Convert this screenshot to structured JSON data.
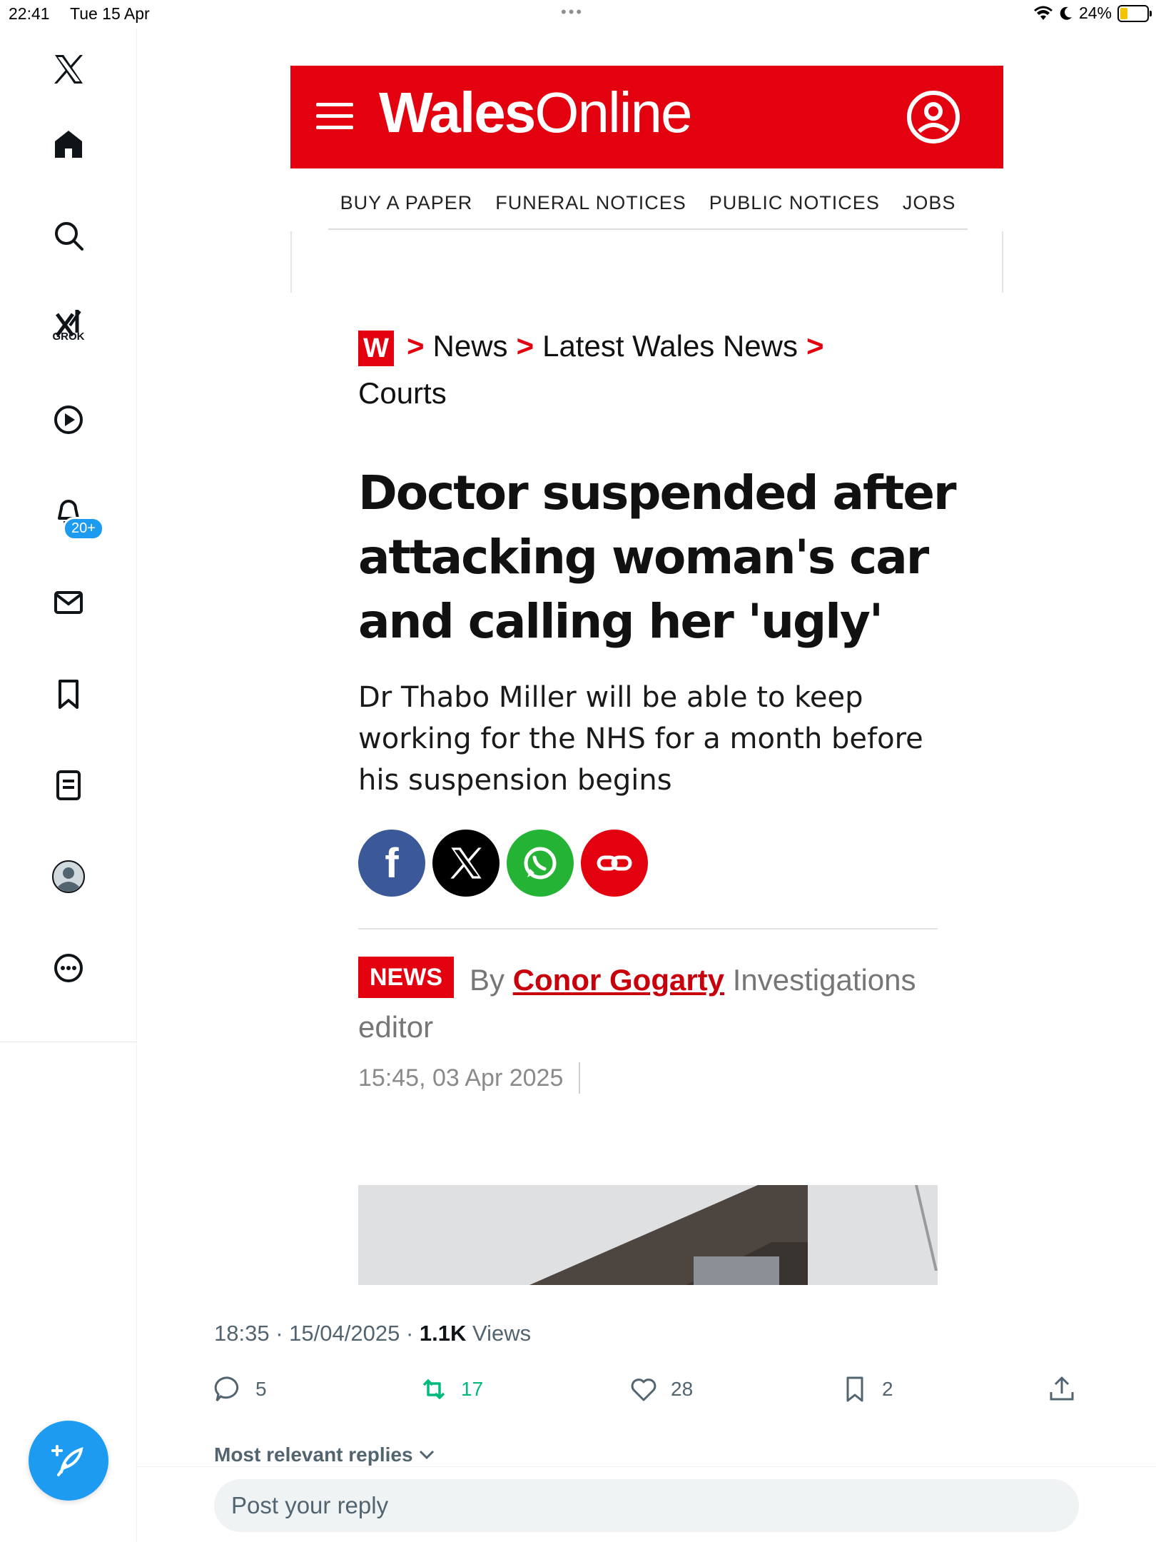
{
  "status": {
    "time": "22:41",
    "date": "Tue 15 Apr",
    "dots": "•••",
    "battery": "24%"
  },
  "sidebar": {
    "items": [
      {
        "name": "x-logo"
      },
      {
        "name": "home"
      },
      {
        "name": "search"
      },
      {
        "name": "grok",
        "label": "GROK"
      },
      {
        "name": "video"
      },
      {
        "name": "notifications",
        "badge": "20+"
      },
      {
        "name": "messages"
      },
      {
        "name": "bookmarks"
      },
      {
        "name": "lists"
      },
      {
        "name": "profile"
      },
      {
        "name": "more"
      }
    ],
    "accent": "#1d9bf0"
  },
  "article": {
    "brand_bold": "Wales",
    "brand_light": "Online",
    "brand_color": "#e3000f",
    "nav": [
      "BUY A PAPER",
      "FUNERAL NOTICES",
      "PUBLIC NOTICES",
      "JOBS"
    ],
    "breadcrumb_logo": "W",
    "breadcrumbs": [
      "News",
      "Latest Wales News",
      "Courts"
    ],
    "breadcrumb_sep": ">",
    "headline": "Doctor suspended after attacking woman's car and calling her 'ugly'",
    "standfirst": "Dr Thabo Miller will be able to keep working for the NHS for a month before his suspension begins",
    "share_fb": "f",
    "tag": "NEWS",
    "by": "By",
    "author": "Conor Gogarty",
    "author_role": "Investigations editor",
    "published": "15:45, 03 Apr 2025"
  },
  "tweet": {
    "time": "18:35",
    "sep": "·",
    "date": "15/04/2025",
    "views_count": "1.1K",
    "views_label": "Views",
    "replies": "5",
    "reposts": "17",
    "likes": "28",
    "bookmarks": "2",
    "replies_sort": "Most relevant replies",
    "reply_placeholder": "Post your reply"
  }
}
